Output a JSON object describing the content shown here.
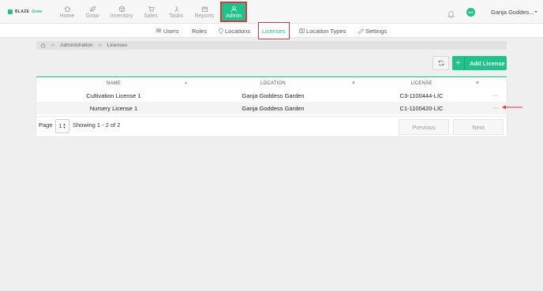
{
  "brand": {
    "name": "BLAZE",
    "product": "Grow"
  },
  "nav": {
    "items": [
      {
        "label": "Home",
        "icon": "home-icon"
      },
      {
        "label": "Grow",
        "icon": "leaf-icon"
      },
      {
        "label": "Inventory",
        "icon": "box-icon"
      },
      {
        "label": "Sales",
        "icon": "cart-icon"
      },
      {
        "label": "Tasks",
        "icon": "tasks-icon"
      },
      {
        "label": "Reports",
        "icon": "reports-icon"
      },
      {
        "label": "Admin",
        "icon": "user-icon",
        "active": true
      }
    ]
  },
  "user": {
    "initials": "GG",
    "name": "Ganja Goddes..."
  },
  "subnav": {
    "items": [
      {
        "label": "Users"
      },
      {
        "label": "Roles"
      },
      {
        "label": "Locations"
      },
      {
        "label": "Licenses",
        "active": true
      },
      {
        "label": "Location Types"
      },
      {
        "label": "Settings"
      }
    ]
  },
  "breadcrumb": {
    "items": [
      "Administration",
      "Licenses"
    ]
  },
  "actions": {
    "add_label": "Add License",
    "plus": "+"
  },
  "table": {
    "headers": [
      "NAME",
      "LOCATION",
      "LICENSE"
    ],
    "sort_glyph": "◆",
    "rows": [
      {
        "name": "Cultivation License 1",
        "location": "Ganja Goddess Garden",
        "license": "C3-1100444-LIC",
        "menu": "···"
      },
      {
        "name": "Nursery License 1",
        "location": "Ganja Goddess Garden",
        "license": "C1-1100420-LIC",
        "menu": "···"
      }
    ]
  },
  "pagination": {
    "page_label": "Page",
    "page_value": "1",
    "showing": "Showing 1 - 2 of 2",
    "previous": "Previous",
    "next": "Next"
  },
  "colors": {
    "accent": "#1ec28b",
    "highlight": "#d9363e"
  }
}
